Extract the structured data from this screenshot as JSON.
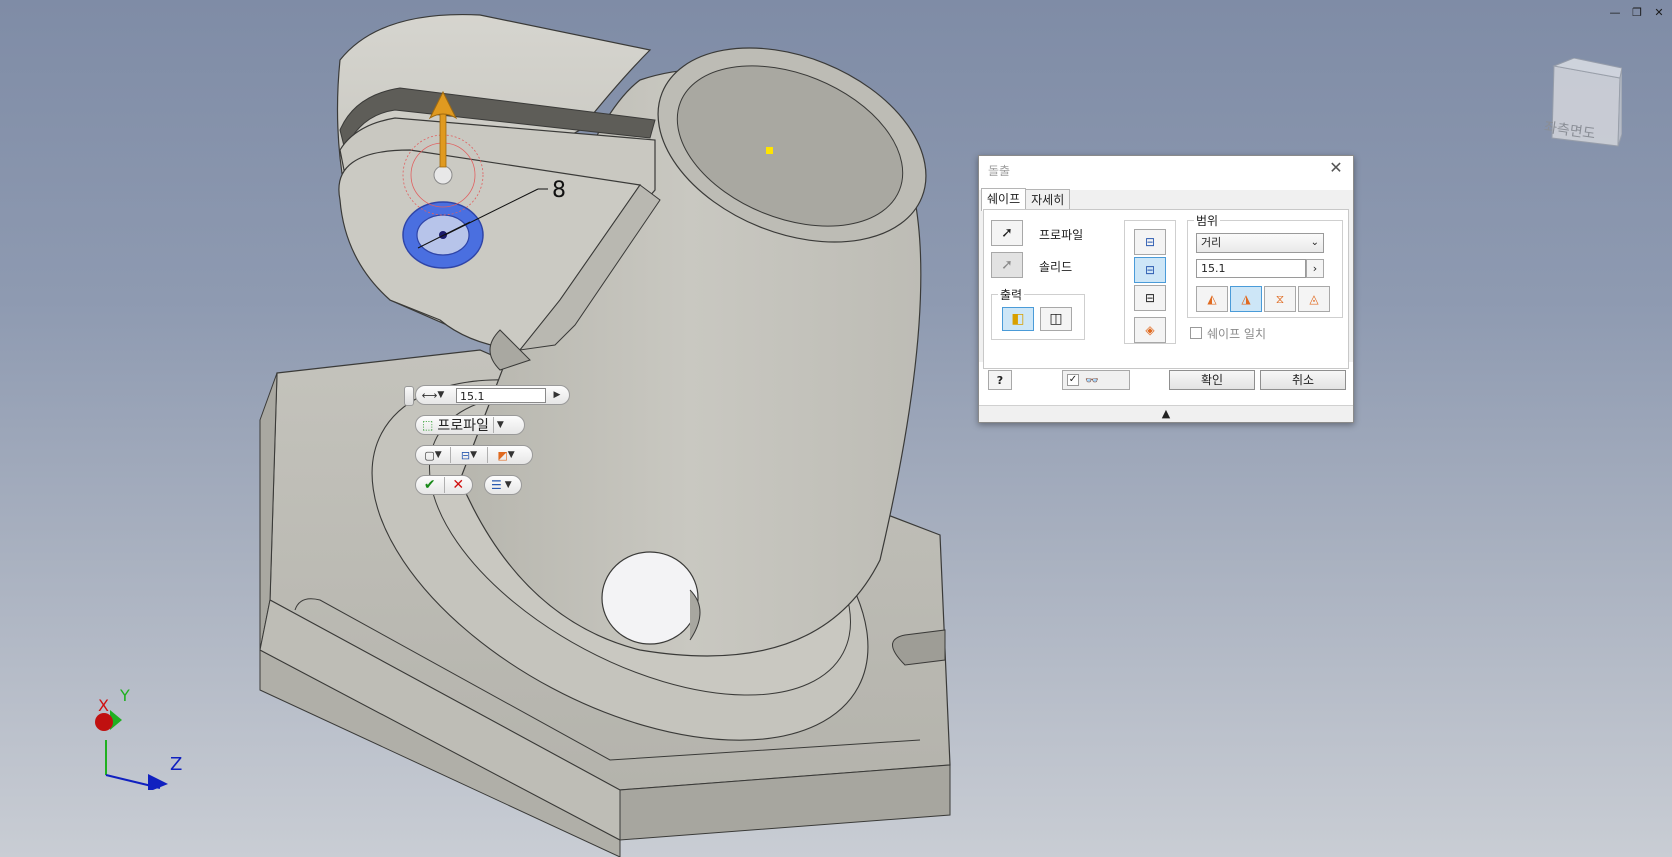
{
  "window_controls": {
    "minimize": "—",
    "restore": "❐",
    "close": "✕"
  },
  "viewcube": {
    "face_label": "좌측면도"
  },
  "triad": {
    "x": "X",
    "y": "Y",
    "z": "Z"
  },
  "model": {
    "dimension_label": "8"
  },
  "minitoolbar": {
    "distance_value": "15.1",
    "profile_label": "프로파일"
  },
  "dialog": {
    "title": "돌출",
    "tabs": [
      "쉐이프",
      "자세히"
    ],
    "profile_label": "프로파일",
    "solid_label": "솔리드",
    "output_group": "출력",
    "extents_group": "범위",
    "extents_type": "거리",
    "distance_value": "15.1",
    "match_shape_label": "쉐이프 일치",
    "ok_label": "확인",
    "cancel_label": "취소",
    "help_label": "?"
  },
  "colors": {
    "background_top": "#7f8ca6",
    "background_bottom": "#c9cdd4",
    "part_face": "#c7c6c0",
    "highlight_blue": "#4a6fe0",
    "selected_button": "#cde6f7",
    "x_axis": "#d01010",
    "y_axis": "#20b020",
    "z_axis": "#1020c0",
    "arrow_orange": "#e09a20"
  }
}
